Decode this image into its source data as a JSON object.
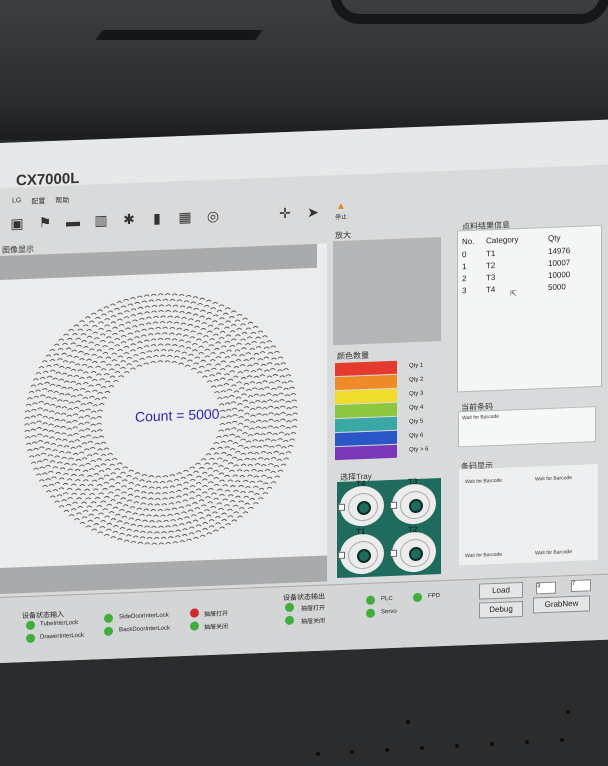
{
  "app": {
    "title": "CX7000L"
  },
  "menu": [
    "LG",
    "配置",
    "帮助"
  ],
  "toolbar": {
    "stop_label": "停止"
  },
  "image_panel": {
    "label": "图像显示",
    "count_text": "Count = 5000"
  },
  "zoom": {
    "label": "放大"
  },
  "color_qty": {
    "label": "颜色数量",
    "items": [
      {
        "color": "#e53a2e",
        "label": "Qty 1"
      },
      {
        "color": "#ef8a29",
        "label": "Qty 2"
      },
      {
        "color": "#f0dc2c",
        "label": "Qty 3"
      },
      {
        "color": "#8dc63f",
        "label": "Qty 4"
      },
      {
        "color": "#3aa8a4",
        "label": "Qty 5"
      },
      {
        "color": "#2b56c7",
        "label": "Qty 6"
      },
      {
        "color": "#7a38b8",
        "label": "Qty > 6"
      }
    ]
  },
  "tray": {
    "label": "选择Tray",
    "items": [
      "T4",
      "T3",
      "T1",
      "T2"
    ]
  },
  "results": {
    "label": "点料结果信息",
    "headers": [
      "No.",
      "Category",
      "Qty"
    ],
    "rows": [
      [
        "0",
        "T1",
        "14976"
      ],
      [
        "1",
        "T2",
        "10007"
      ],
      [
        "2",
        "T3",
        "10000"
      ],
      [
        "3",
        "T4",
        "5000"
      ]
    ]
  },
  "current_barcode": {
    "label": "当前条码",
    "value": "Wait for Barcode"
  },
  "barcode_display": {
    "label": "条码显示",
    "items": [
      "Wait for Barcode",
      "Wait for Barcode",
      "Wait for Barcode",
      "Wait for Barcode"
    ]
  },
  "status_input": {
    "label": "设备状态输入",
    "items": [
      {
        "label": "TubeInterLock",
        "color": "green"
      },
      {
        "label": "SideDoorInterLock",
        "color": "green"
      },
      {
        "label": "抽屉打开",
        "color": "red"
      },
      {
        "label": "DrawerInterLock",
        "color": "green"
      },
      {
        "label": "BackDoorInterLock",
        "color": "green"
      },
      {
        "label": "抽屉关闭",
        "color": "green"
      }
    ]
  },
  "status_output": {
    "label": "设备状态输出",
    "items": [
      {
        "label": "抽屉打开",
        "color": "green"
      },
      {
        "label": "PLC",
        "color": "green"
      },
      {
        "label": "FPD",
        "color": "green"
      },
      {
        "label": "抽屉关闭",
        "color": "green"
      },
      {
        "label": "Servo",
        "color": "green"
      }
    ]
  },
  "controls": {
    "load": "Load",
    "debug": "Debug",
    "grabnew": "GrabNew",
    "input1": "3",
    "input2": "7"
  }
}
